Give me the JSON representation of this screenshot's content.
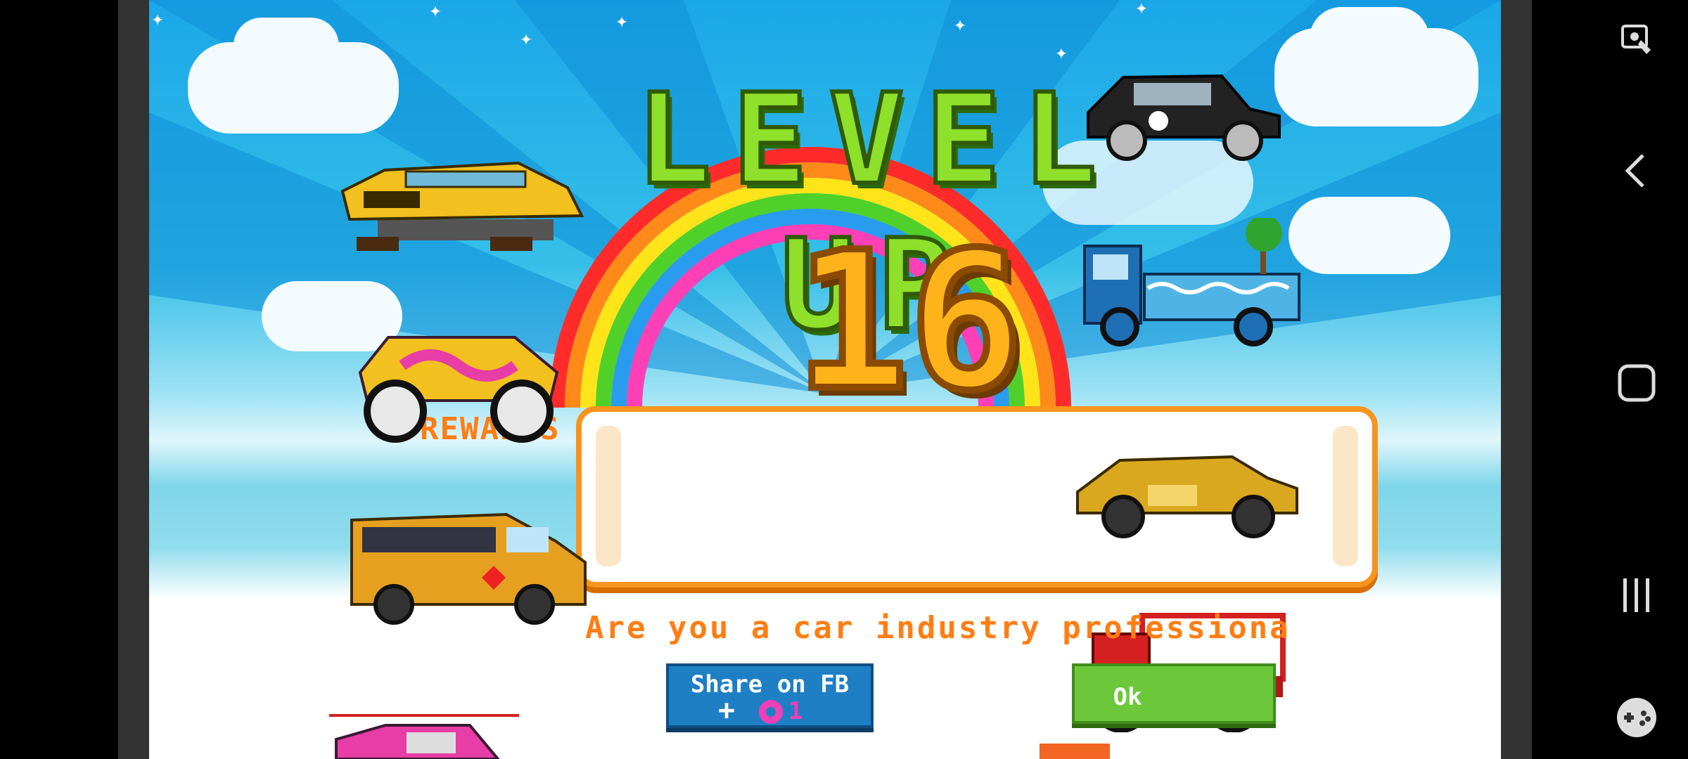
{
  "screen": {
    "title": "LEVEL UP",
    "level": "16",
    "rewards_label": "REWARDS",
    "question": "Are you a car industry professiona",
    "share_button": {
      "label": "Share on FB",
      "plus": "+",
      "reward_count": "1",
      "reward_icon": "donut-icon"
    },
    "ok_button": {
      "label": "Ok"
    }
  },
  "nav_bar": {
    "items": [
      "game-tools-icon",
      "back-icon",
      "home-icon",
      "recents-icon",
      "game-launcher-icon"
    ]
  },
  "colors": {
    "sky": "#1aa7e8",
    "title_green": "#8ee02a",
    "accent_orange": "#ff7d12",
    "share_blue": "#1e7fc5",
    "ok_green": "#6cc83a",
    "donut_pink": "#f040b8"
  }
}
